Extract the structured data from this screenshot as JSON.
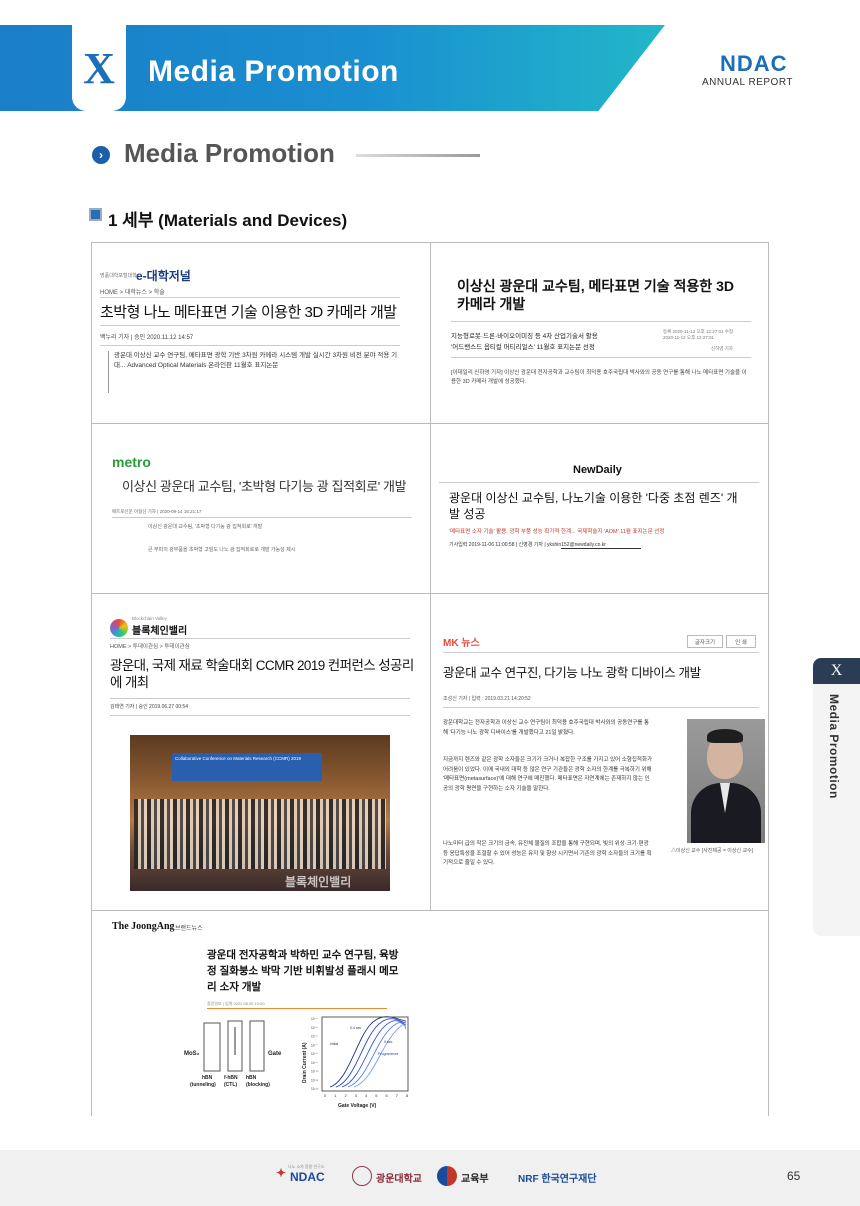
{
  "header": {
    "chapter": "X",
    "title": "Media Promotion",
    "logo": "NDAC",
    "logo_sub": "ANNUAL REPORT"
  },
  "section": {
    "title": "Media Promotion",
    "subtitle": "1 세부  (Materials and Devices)"
  },
  "articles": {
    "a1": {
      "source": "e-대학저널",
      "source_tag": "명품대학포털대학",
      "nav": "HOME  >  대학뉴스  >  학술",
      "headline": "초박형 나노 메타표면 기술 이용한 3D 카메라 개발",
      "byline": "백누리 기자  |  승인 2020.11.12 14:57",
      "body": "광운대 이상신 교수 연구팀, 메타표면 광학 기반 3차원 카메라 시스템 개발 실시간 3차원 비전 분야 적용 기대... Advanced Optical Materials 온라인판 11월호 표지논문"
    },
    "a2": {
      "headline": "이상신 광운대 교수팀, 메타표면 기술 적용한 3D 카메라 개발",
      "sub1": "지능형로봇·드론·바이오이미징 등 4차 산업기술서 활용",
      "sub2": "'어드밴스드 옵티컬 머티리얼스' 11월호 표지논문 선정",
      "dates": "등록 2020-11-12 오후 12:27:01  수정 2020-11-12 오후 12:27:01",
      "reporter": "신하영 기자",
      "body": "[이데일리 신하영 기자] 이상신 광운대 전자공학과 교수팀이 최덕용 호주국립대 박사와의 공동 연구를 통해 나노 메타표면 기술을 이용한 3D 카메라 개발에 성공했다."
    },
    "a3": {
      "source": "metro",
      "headline": "이상신 광운대 교수팀, '초박형 다기능 광 집적회로' 개발",
      "byline": "메트로신문 이형선 기자  |  2020-09-14 16:21:17",
      "line1": "이상신 광운대 교수팀, '초박형 다기능 광 집적회로' 개발",
      "line2": "큰 부피의 광부품을 초박형 고밀도 나노 광 집적회로로 개발 가능성 제시"
    },
    "a4": {
      "source": "NewDaily",
      "headline": "광운대 이상신 교수팀, 나노기술 이용한 '다중 초점 렌즈' 개발 성공",
      "sub": "'메타표면 소자 기술' 활용, 광학 부품 성능 획기적 한계... 국제학술지 'AOM' 11월 표지논문 선정",
      "byline": "기사입력 2019-11-06 11:00:58 | 신영경 기자 | ykshin152@newdaily.co.kr"
    },
    "a5": {
      "source": "블록체인밸리",
      "source_tag": "Blockchain Valley",
      "nav": "HOME  >  투데이관심  >  투데이관심",
      "headline": "광운대, 국제 재료 학술대회 CCMR 2019 컨퍼런스 성공리에 개최",
      "byline": "김태연 기자  |  승인 2019.06.27 00:54",
      "photo_banner": "Collaborative Conference on Materials Research (CCMR) 2019",
      "watermark": "블록체인밸리"
    },
    "a6": {
      "source": "MK 뉴스",
      "btn1": "글자크기",
      "btn2": "인 쇄",
      "headline": "광운대 교수 연구진, 다기능 나노 광학 디바이스 개발",
      "byline": "조성신 기자  |  입력 : 2019.03.21 14:20:52",
      "p1": "광운대학교는 전자공학과 이상신 교수 연구팀이 최덕용 호주국립대 박사와의 공동연구를 통해 '다기능 나노 광학 디바이스'를 개발했다고 21일 밝혔다.",
      "p2": "지금까지 렌즈와 같은 광학 소자들은 크기가 크거나 복잡한 구조를 가지고 있어 소형집적화가 어려움이 있었다. 이에 국내외 대학 등 많은 연구 기관들은 광학 소자의 한계를 극복하기 위해 '메타표면(metasurface)'에 대해 연구에 매진했다. 메타표면은 자연계에는 존재하지 않는 인공의 광학 평면을 구현하는 소자 기술을 말한다.",
      "p3": "나노미터 급의 작은 크기의 금속, 유전체 물질의 조합을 통해 구현되며, 빛의 위상·크기·편광 등 응답특성을 조절할 수 있어 성능은 유지 및 향상 시키면서 기존의 광학 소자들의 크기를 획기적으로 줄일 수 있다.",
      "caption": "△이상신 교수 [사진제공 = 이상신 교수]"
    },
    "a7": {
      "source": "The JoongAng",
      "source_tag": "브랜드뉴스",
      "headline": "광운대 전자공학과 박하민 교수 연구팀, 육방정 질화붕소 박막 기반 비휘발성 플래시 메모리 소자 개발",
      "byline": "중앙일보  |  입력 2022.08.05 10:00",
      "diagram": {
        "mos2": "MoS₂",
        "gate": "Gate",
        "l1": "hBN",
        "l1b": "(tunneling)",
        "l2": "f-hBN",
        "l2b": "(CTL)",
        "l3": "hBN",
        "l3b": "(blocking)"
      },
      "plot": {
        "ylabel": "Drain Current (A)",
        "xlabel": "Gate Voltage (V)",
        "yticks": [
          "10⁻⁴",
          "10⁻⁵",
          "10⁻⁶",
          "10⁻⁷",
          "10⁻⁸",
          "10⁻⁹",
          "10⁻¹⁰",
          "10⁻¹¹",
          "10⁻¹²"
        ],
        "xticks": [
          "0",
          "1",
          "2",
          "3",
          "4",
          "5",
          "6",
          "7",
          "8"
        ],
        "ann1": "0.4 sec",
        "ann2": "0 sec",
        "ann3": "Initial",
        "ann4": "Programmed"
      }
    }
  },
  "side_tab": {
    "chapter": "X",
    "label": "Media Promotion"
  },
  "footer": {
    "logo1": "NDAC",
    "logo1_tag": "나노 소자 응용 연구소",
    "logo2": "광운대학교",
    "logo3": "교육부",
    "logo4": "NRF 한국연구재단",
    "page": "65"
  }
}
